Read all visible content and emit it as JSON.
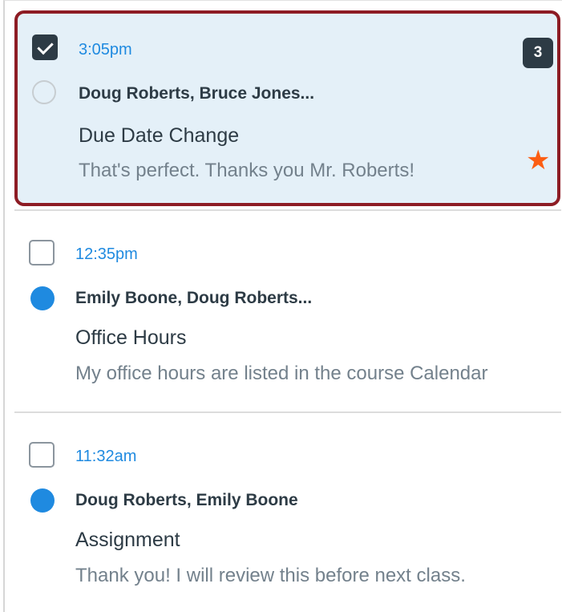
{
  "messages": [
    {
      "time": "3:05pm",
      "participants": "Doug Roberts, Bruce Jones...",
      "subject": "Due Date Change",
      "preview": "That's perfect. Thanks you Mr. Roberts!",
      "count": "3",
      "checked": true,
      "read": true,
      "starred": true,
      "selected": true
    },
    {
      "time": "12:35pm",
      "participants": "Emily Boone, Doug Roberts...",
      "subject": "Office Hours",
      "preview": "My office hours are listed in the course Calendar",
      "checked": false,
      "read": false,
      "starred": false,
      "selected": false
    },
    {
      "time": "11:32am",
      "participants": "Doug Roberts, Emily Boone",
      "subject": "Assignment",
      "preview": "Thank you! I will review this before next class.",
      "checked": false,
      "read": false,
      "starred": false,
      "selected": false
    }
  ],
  "colors": {
    "time": "#1f8ae0",
    "selected_bg": "#e4f0f8",
    "selected_border": "#8d1c24",
    "star": "#fc5e13",
    "unread_dot": "#1f8ae0",
    "badge": "#2d3b45"
  },
  "icons": {
    "checkbox_checked": "checkmark-icon",
    "star": "star-icon",
    "read_indicator": "read-circle-icon",
    "unread_indicator": "unread-dot-icon"
  }
}
